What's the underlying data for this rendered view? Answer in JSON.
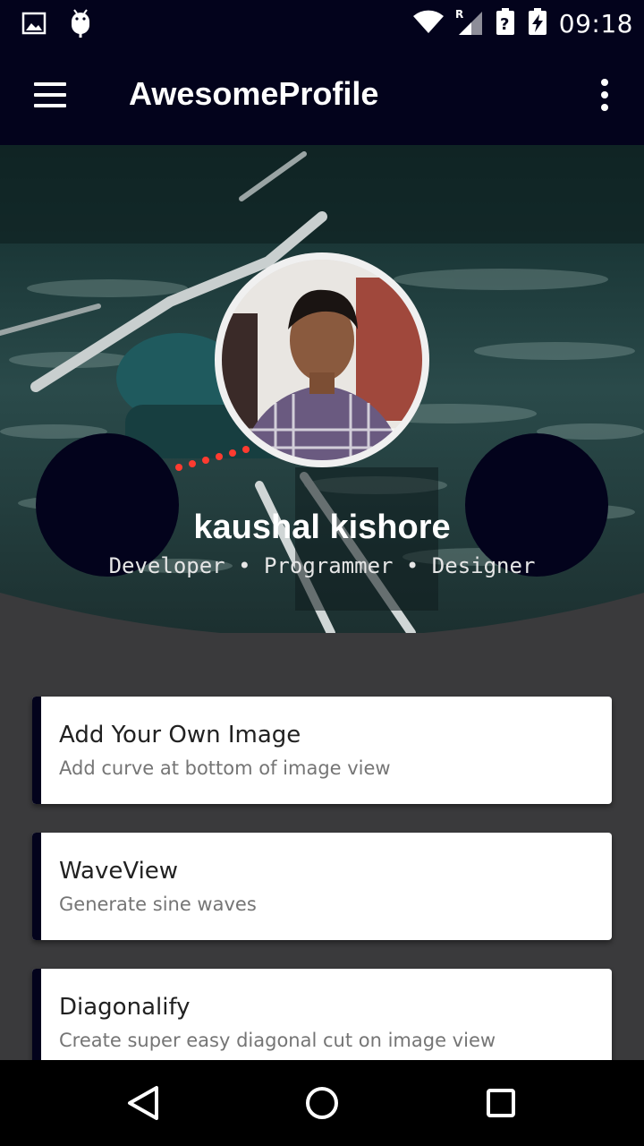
{
  "status_bar": {
    "time": "09:18",
    "icons": [
      "image-notification-icon",
      "android-debug-icon",
      "wifi-icon",
      "cell-signal-roaming-icon",
      "battery-unknown-icon",
      "battery-charging-icon"
    ]
  },
  "app_bar": {
    "title": "AwesomeProfile",
    "menu_icon": "hamburger-menu-icon",
    "overflow_icon": "more-vert-icon"
  },
  "profile": {
    "name": "kaushal kishore",
    "roles": "Developer • Programmer • Designer"
  },
  "cards": [
    {
      "title": "Add Your Own Image",
      "subtitle": "Add curve at bottom of image view"
    },
    {
      "title": "WaveView",
      "subtitle": "Generate sine waves"
    },
    {
      "title": "Diagonalify",
      "subtitle": "Create super easy diagonal cut on image view"
    }
  ],
  "nav_bar": {
    "back_icon": "back-triangle-icon",
    "home_icon": "home-circle-icon",
    "recents_icon": "recents-square-icon"
  },
  "colors": {
    "primary_dark": "#03031c",
    "background": "#3a3a3c",
    "card": "#ffffff"
  }
}
